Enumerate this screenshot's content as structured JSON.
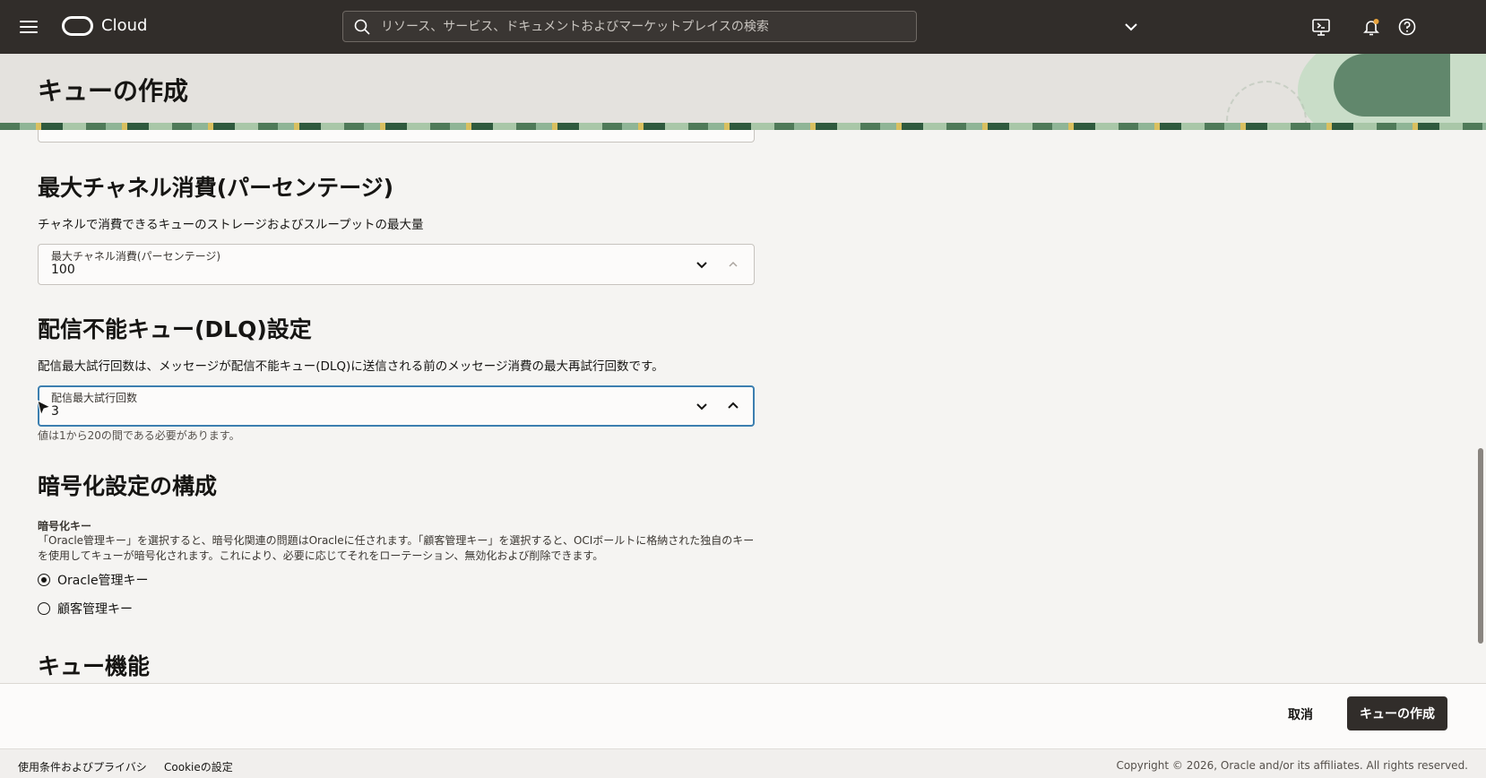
{
  "topbar": {
    "brand": "Cloud",
    "search_placeholder": "リソース、サービス、ドキュメントおよびマーケットプレイスの検索"
  },
  "header": {
    "title": "キューの作成"
  },
  "sections": {
    "channel_consumption": {
      "title": "最大チャネル消費(パーセンテージ)",
      "description": "チャネルで消費できるキューのストレージおよびスループットの最大量",
      "field_label": "最大チャネル消費(パーセンテージ)",
      "field_value": "100"
    },
    "dlq": {
      "title": "配信不能キュー(DLQ)設定",
      "description": "配信最大試行回数は、メッセージが配信不能キュー(DLQ)に送信される前のメッセージ消費の最大再試行回数です。",
      "field_label": "配信最大試行回数",
      "field_value": "3",
      "hint": "値は1から20の間である必要があります。"
    },
    "encryption": {
      "title": "暗号化設定の構成",
      "key_label": "暗号化キー",
      "key_description": "「Oracle管理キー」を選択すると、暗号化関連の問題はOracleに任されます。「顧客管理キー」を選択すると、OCIボールトに格納された独自のキーを使用してキューが暗号化されます。これにより、必要に応じてそれをローテーション、無効化および削除できます。",
      "options": [
        {
          "label": "Oracle管理キー",
          "selected": true
        },
        {
          "label": "顧客管理キー",
          "selected": false
        }
      ]
    },
    "queue_features": {
      "title": "キュー機能"
    }
  },
  "actions": {
    "cancel_label": "取消",
    "create_label": "キューの作成"
  },
  "footer": {
    "terms_label": "使用条件およびプライバシ",
    "cookie_label": "Cookieの設定",
    "copyright": "Copyright © 2026, Oracle and/or its affiliates. All rights reserved."
  },
  "colors": {
    "topbar_bg": "#312d2a",
    "focus_border": "#3c7fb0",
    "primary_button": "#312d2a"
  },
  "icons": [
    "hamburger-icon",
    "oracle-logo-icon",
    "search-icon",
    "chevron-down-icon",
    "cloud-shell-icon",
    "bell-icon",
    "help-icon"
  ]
}
